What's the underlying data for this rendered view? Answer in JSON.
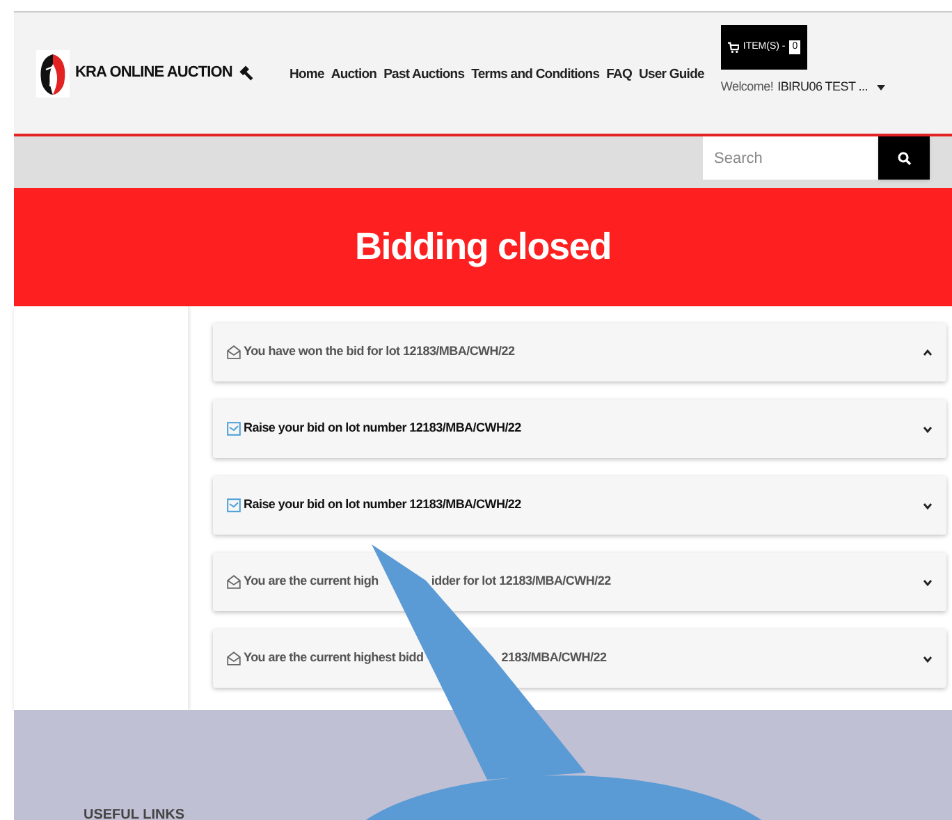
{
  "header": {
    "logo_text": "KRA ONLINE AUCTION",
    "nav": [
      "Home",
      "Auction",
      "Past Auctions",
      "Terms and Conditions",
      "FAQ",
      "User Guide"
    ],
    "cart": {
      "label": "ITEM(S) -",
      "count": "0"
    },
    "welcome": "Welcome!",
    "user": "IBIRU06 TEST ..."
  },
  "search": {
    "placeholder": "Search"
  },
  "banner": {
    "title": "Bidding closed"
  },
  "notifications": [
    {
      "text": [
        "You have won the bid for lot 12183/MBA/CWH/22"
      ],
      "unread": false,
      "expanded": true
    },
    {
      "text": [
        "Raise your bid on lot number 12183/MBA/CWH/22"
      ],
      "unread": true,
      "expanded": false
    },
    {
      "text": [
        "Raise your bid on lot number 12183/MBA/CWH/22"
      ],
      "unread": true,
      "expanded": false
    },
    {
      "text": [
        "You are the current high",
        "idder for lot 12183/MBA/CWH/22"
      ],
      "unread": false,
      "expanded": false
    },
    {
      "text": [
        "You are the current highest bidd",
        "2183/MBA/CWH/22"
      ],
      "unread": false,
      "expanded": false
    }
  ],
  "footer": {
    "heading": "USEFUL LINKS"
  }
}
